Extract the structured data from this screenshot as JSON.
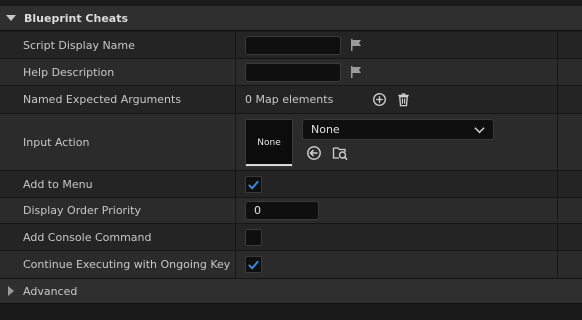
{
  "section": {
    "title": "Blueprint Cheats"
  },
  "rows": {
    "script_display_name": {
      "label": "Script Display Name",
      "value": ""
    },
    "help_description": {
      "label": "Help Description",
      "value": ""
    },
    "named_expected_arguments": {
      "label": "Named Expected Arguments",
      "value": "0 Map elements"
    },
    "input_action": {
      "label": "Input Action",
      "thumbnail": "None",
      "selected": "None"
    },
    "add_to_menu": {
      "label": "Add to Menu",
      "checked": true
    },
    "display_order_priority": {
      "label": "Display Order Priority",
      "value": "0"
    },
    "add_console_command": {
      "label": "Add Console Command",
      "checked": false
    },
    "continue_executing": {
      "label": "Continue Executing with Ongoing Key Pr...",
      "checked": true
    }
  },
  "advanced": {
    "label": "Advanced"
  },
  "colors": {
    "accent": "#3b8ee5",
    "background": "#1a1a1a",
    "row": "#242424",
    "row_alt": "#2b2b2b"
  }
}
